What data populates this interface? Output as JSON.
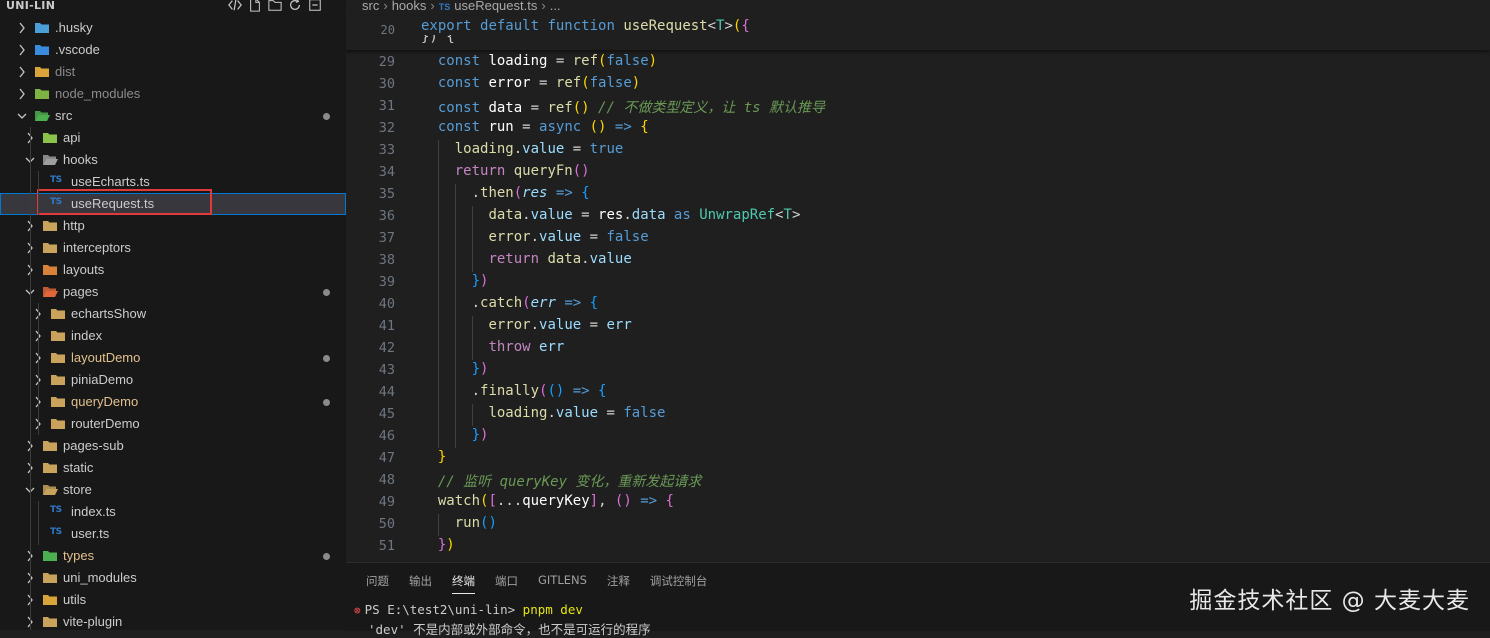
{
  "explorer": {
    "title": "UNI-LIN",
    "items": [
      {
        "label": ".husky",
        "depth": 0,
        "kind": "folder",
        "color": "#4a9fd8",
        "expanded": false,
        "dim": false,
        "mod": false,
        "dot": false,
        "selected": false
      },
      {
        "label": ".vscode",
        "depth": 0,
        "kind": "folder",
        "color": "#3a8dde",
        "expanded": false,
        "dim": false,
        "mod": false,
        "dot": false,
        "selected": false
      },
      {
        "label": "dist",
        "depth": 0,
        "kind": "folder",
        "color": "#d9a43a",
        "expanded": false,
        "dim": true,
        "mod": false,
        "dot": false,
        "selected": false
      },
      {
        "label": "node_modules",
        "depth": 0,
        "kind": "folder",
        "color": "#7cb342",
        "expanded": false,
        "dim": true,
        "mod": false,
        "dot": false,
        "selected": false
      },
      {
        "label": "src",
        "depth": 0,
        "kind": "folder-open",
        "color": "#4caf50",
        "expanded": true,
        "dim": false,
        "mod": false,
        "dot": true,
        "selected": false
      },
      {
        "label": "api",
        "depth": 1,
        "kind": "folder",
        "color": "#8bc34a",
        "expanded": false,
        "dim": false,
        "mod": false,
        "dot": false,
        "selected": false
      },
      {
        "label": "hooks",
        "depth": 1,
        "kind": "folder-open",
        "color": "#9e9e9e",
        "expanded": true,
        "dim": false,
        "mod": false,
        "dot": false,
        "selected": false
      },
      {
        "label": "useEcharts.ts",
        "depth": 2,
        "kind": "ts",
        "color": "#3178c6",
        "expanded": false,
        "dim": false,
        "mod": false,
        "dot": false,
        "selected": false
      },
      {
        "label": "useRequest.ts",
        "depth": 2,
        "kind": "ts",
        "color": "#3178c6",
        "expanded": false,
        "dim": false,
        "mod": false,
        "dot": false,
        "selected": true
      },
      {
        "label": "http",
        "depth": 1,
        "kind": "folder",
        "color": "#c9a35c",
        "expanded": false,
        "dim": false,
        "mod": false,
        "dot": false,
        "selected": false
      },
      {
        "label": "interceptors",
        "depth": 1,
        "kind": "folder",
        "color": "#c9a35c",
        "expanded": false,
        "dim": false,
        "mod": false,
        "dot": false,
        "selected": false
      },
      {
        "label": "layouts",
        "depth": 1,
        "kind": "folder",
        "color": "#d9823a",
        "expanded": false,
        "dim": false,
        "mod": false,
        "dot": false,
        "selected": false
      },
      {
        "label": "pages",
        "depth": 1,
        "kind": "folder-open",
        "color": "#e0673a",
        "expanded": true,
        "dim": false,
        "mod": false,
        "dot": true,
        "selected": false
      },
      {
        "label": "echartsShow",
        "depth": 2,
        "kind": "folder",
        "color": "#c9a35c",
        "expanded": false,
        "dim": false,
        "mod": false,
        "dot": false,
        "selected": false
      },
      {
        "label": "index",
        "depth": 2,
        "kind": "folder",
        "color": "#c9a35c",
        "expanded": false,
        "dim": false,
        "mod": false,
        "dot": false,
        "selected": false
      },
      {
        "label": "layoutDemo",
        "depth": 2,
        "kind": "folder",
        "color": "#c9a35c",
        "expanded": false,
        "dim": false,
        "mod": true,
        "dot": true,
        "selected": false
      },
      {
        "label": "piniaDemo",
        "depth": 2,
        "kind": "folder",
        "color": "#c9a35c",
        "expanded": false,
        "dim": false,
        "mod": false,
        "dot": false,
        "selected": false
      },
      {
        "label": "queryDemo",
        "depth": 2,
        "kind": "folder",
        "color": "#c9a35c",
        "expanded": false,
        "dim": false,
        "mod": true,
        "dot": true,
        "selected": false
      },
      {
        "label": "routerDemo",
        "depth": 2,
        "kind": "folder",
        "color": "#c9a35c",
        "expanded": false,
        "dim": false,
        "mod": false,
        "dot": false,
        "selected": false
      },
      {
        "label": "pages-sub",
        "depth": 1,
        "kind": "folder",
        "color": "#c9a35c",
        "expanded": false,
        "dim": false,
        "mod": false,
        "dot": false,
        "selected": false
      },
      {
        "label": "static",
        "depth": 1,
        "kind": "folder",
        "color": "#c9a35c",
        "expanded": false,
        "dim": false,
        "mod": false,
        "dot": false,
        "selected": false
      },
      {
        "label": "store",
        "depth": 1,
        "kind": "folder-open",
        "color": "#c9a35c",
        "expanded": true,
        "dim": false,
        "mod": false,
        "dot": false,
        "selected": false
      },
      {
        "label": "index.ts",
        "depth": 2,
        "kind": "ts",
        "color": "#3178c6",
        "expanded": false,
        "dim": false,
        "mod": false,
        "dot": false,
        "selected": false
      },
      {
        "label": "user.ts",
        "depth": 2,
        "kind": "ts",
        "color": "#3178c6",
        "expanded": false,
        "dim": false,
        "mod": false,
        "dot": false,
        "selected": false
      },
      {
        "label": "types",
        "depth": 1,
        "kind": "folder",
        "color": "#4caf50",
        "expanded": false,
        "dim": false,
        "mod": true,
        "dot": true,
        "selected": false
      },
      {
        "label": "uni_modules",
        "depth": 1,
        "kind": "folder",
        "color": "#c9a35c",
        "expanded": false,
        "dim": false,
        "mod": false,
        "dot": false,
        "selected": false
      },
      {
        "label": "utils",
        "depth": 1,
        "kind": "folder",
        "color": "#d9a43a",
        "expanded": false,
        "dim": false,
        "mod": false,
        "dot": false,
        "selected": false
      },
      {
        "label": "vite-plugin",
        "depth": 1,
        "kind": "folder",
        "color": "#c9a35c",
        "expanded": false,
        "dim": false,
        "mod": false,
        "dot": false,
        "selected": false
      }
    ]
  },
  "breadcrumb": {
    "parts": [
      "src",
      "hooks"
    ],
    "file_badge": "TS",
    "file": "useRequest.ts",
    "tail": "..."
  },
  "editor": {
    "sticky": {
      "number": "20",
      "partial": "}) {"
    },
    "lines": [
      {
        "n": "29",
        "indent": 1,
        "tokens": [
          [
            "kw",
            "const "
          ],
          [
            "bvar",
            "loading"
          ],
          [
            "punc",
            " = "
          ],
          [
            "fn",
            "ref"
          ],
          [
            "p1",
            "("
          ],
          [
            "kw",
            "false"
          ],
          [
            "p1",
            ")"
          ]
        ]
      },
      {
        "n": "30",
        "indent": 1,
        "tokens": [
          [
            "kw",
            "const "
          ],
          [
            "bvar",
            "error"
          ],
          [
            "punc",
            " = "
          ],
          [
            "fn",
            "ref"
          ],
          [
            "p1",
            "("
          ],
          [
            "kw",
            "false"
          ],
          [
            "p1",
            ")"
          ]
        ]
      },
      {
        "n": "31",
        "indent": 1,
        "tokens": [
          [
            "kw",
            "const "
          ],
          [
            "bvar",
            "data"
          ],
          [
            "punc",
            " = "
          ],
          [
            "fn",
            "ref"
          ],
          [
            "p1",
            "()"
          ],
          [
            "cmt",
            " // 不做类型定义，让 ts 默认推导"
          ]
        ]
      },
      {
        "n": "32",
        "indent": 1,
        "tokens": [
          [
            "kw",
            "const "
          ],
          [
            "bvar",
            "run"
          ],
          [
            "punc",
            " = "
          ],
          [
            "kw",
            "async "
          ],
          [
            "p1",
            "()"
          ],
          [
            "kw",
            " => "
          ],
          [
            "p1",
            "{"
          ]
        ]
      },
      {
        "n": "33",
        "indent": 2,
        "tokens": [
          [
            "yl",
            "loading"
          ],
          [
            "punc",
            "."
          ],
          [
            "var",
            "value"
          ],
          [
            "punc",
            " = "
          ],
          [
            "kw",
            "true"
          ]
        ]
      },
      {
        "n": "34",
        "indent": 2,
        "tokens": [
          [
            "kw2",
            "return "
          ],
          [
            "fn",
            "queryFn"
          ],
          [
            "p2",
            "()"
          ]
        ]
      },
      {
        "n": "35",
        "indent": 3,
        "tokens": [
          [
            "punc",
            "."
          ],
          [
            "fn",
            "then"
          ],
          [
            "p2",
            "("
          ],
          [
            "param",
            "res"
          ],
          [
            "kw",
            " => "
          ],
          [
            "p3",
            "{"
          ]
        ]
      },
      {
        "n": "36",
        "indent": 4,
        "tokens": [
          [
            "yl",
            "data"
          ],
          [
            "punc",
            "."
          ],
          [
            "var",
            "value"
          ],
          [
            "punc",
            " = "
          ],
          [
            "bvar",
            "res"
          ],
          [
            "punc",
            "."
          ],
          [
            "var",
            "data"
          ],
          [
            "kw",
            " as "
          ],
          [
            "type",
            "UnwrapRef"
          ],
          [
            "punc",
            "<"
          ],
          [
            "tp",
            "T"
          ],
          [
            "punc",
            ">"
          ]
        ]
      },
      {
        "n": "37",
        "indent": 4,
        "tokens": [
          [
            "yl",
            "error"
          ],
          [
            "punc",
            "."
          ],
          [
            "var",
            "value"
          ],
          [
            "punc",
            " = "
          ],
          [
            "kw",
            "false"
          ]
        ]
      },
      {
        "n": "38",
        "indent": 4,
        "tokens": [
          [
            "kw2",
            "return "
          ],
          [
            "yl",
            "data"
          ],
          [
            "punc",
            "."
          ],
          [
            "var",
            "value"
          ]
        ]
      },
      {
        "n": "39",
        "indent": 3,
        "tokens": [
          [
            "p3",
            "}"
          ],
          [
            "p2",
            ")"
          ]
        ]
      },
      {
        "n": "40",
        "indent": 3,
        "tokens": [
          [
            "punc",
            "."
          ],
          [
            "fn",
            "catch"
          ],
          [
            "p2",
            "("
          ],
          [
            "param",
            "err"
          ],
          [
            "kw",
            " => "
          ],
          [
            "p3",
            "{"
          ]
        ]
      },
      {
        "n": "41",
        "indent": 4,
        "tokens": [
          [
            "yl",
            "error"
          ],
          [
            "punc",
            "."
          ],
          [
            "var",
            "value"
          ],
          [
            "punc",
            " = "
          ],
          [
            "var",
            "err"
          ]
        ]
      },
      {
        "n": "42",
        "indent": 4,
        "tokens": [
          [
            "kw2",
            "throw "
          ],
          [
            "var",
            "err"
          ]
        ]
      },
      {
        "n": "43",
        "indent": 3,
        "tokens": [
          [
            "p3",
            "}"
          ],
          [
            "p2",
            ")"
          ]
        ]
      },
      {
        "n": "44",
        "indent": 3,
        "tokens": [
          [
            "punc",
            "."
          ],
          [
            "fn",
            "finally"
          ],
          [
            "p2",
            "("
          ],
          [
            "p3",
            "()"
          ],
          [
            "kw",
            " => "
          ],
          [
            "p3",
            "{"
          ]
        ]
      },
      {
        "n": "45",
        "indent": 4,
        "tokens": [
          [
            "yl",
            "loading"
          ],
          [
            "punc",
            "."
          ],
          [
            "var",
            "value"
          ],
          [
            "punc",
            " = "
          ],
          [
            "kw",
            "false"
          ]
        ]
      },
      {
        "n": "46",
        "indent": 3,
        "tokens": [
          [
            "p3",
            "}"
          ],
          [
            "p2",
            ")"
          ]
        ]
      },
      {
        "n": "47",
        "indent": 1,
        "tokens": [
          [
            "p1",
            "}"
          ]
        ]
      },
      {
        "n": "48",
        "indent": 1,
        "tokens": [
          [
            "cmt",
            "// 监听 queryKey 变化，重新发起请求"
          ]
        ]
      },
      {
        "n": "49",
        "indent": 1,
        "tokens": [
          [
            "fn",
            "watch"
          ],
          [
            "p1",
            "("
          ],
          [
            "p2",
            "["
          ],
          [
            "punc",
            "..."
          ],
          [
            "bvar",
            "queryKey"
          ],
          [
            "p2",
            "]"
          ],
          [
            "punc",
            ", "
          ],
          [
            "p2",
            "()"
          ],
          [
            "kw",
            " => "
          ],
          [
            "p2",
            "{"
          ]
        ]
      },
      {
        "n": "50",
        "indent": 2,
        "tokens": [
          [
            "fn",
            "run"
          ],
          [
            "p3",
            "()"
          ]
        ]
      },
      {
        "n": "51",
        "indent": 1,
        "tokens": [
          [
            "p2",
            "}"
          ],
          [
            "p1",
            ")"
          ]
        ]
      }
    ],
    "sticky_tokens": [
      [
        "kw",
        "export "
      ],
      [
        "kw",
        "default "
      ],
      [
        "kw",
        "function "
      ],
      [
        "fn",
        "useRequest"
      ],
      [
        "punc",
        "<"
      ],
      [
        "tp",
        "T"
      ],
      [
        "punc",
        ">"
      ],
      [
        "p1",
        "("
      ],
      [
        "p2",
        "{"
      ]
    ]
  },
  "panel": {
    "tabs": [
      "问题",
      "输出",
      "终端",
      "端口",
      "GITLENS",
      "注释",
      "调试控制台"
    ],
    "active_tab": 2,
    "prompt": "PS E:\\test2\\uni-lin> ",
    "command": "pnpm dev",
    "error_line": "'dev' 不是内部或外部命令，也不是可运行的程序"
  },
  "watermark": "掘金技术社区 @ 大麦大麦",
  "colors": {
    "selection_outline": "#0078d4",
    "highlight_box": "#e03a3a",
    "modified_text": "#e2c08d"
  }
}
